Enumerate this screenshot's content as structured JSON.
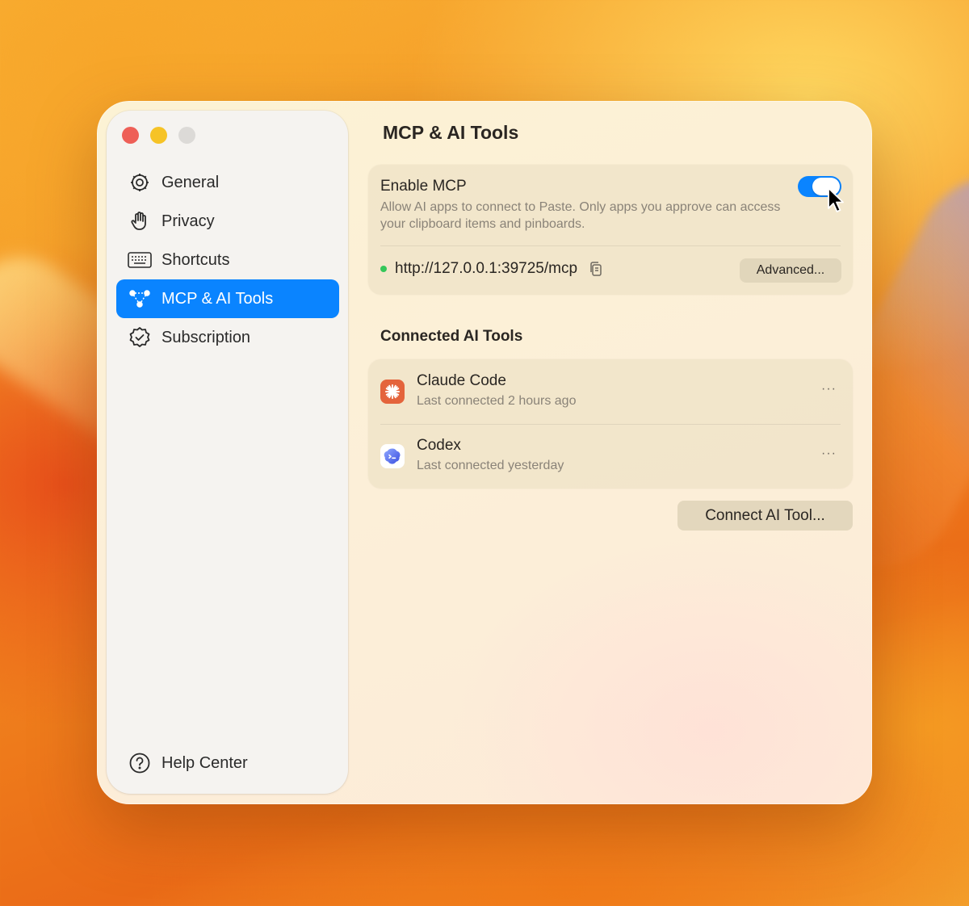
{
  "window": {
    "title": "MCP & AI Tools"
  },
  "sidebar": {
    "items": [
      {
        "label": "General",
        "icon": "gear-icon"
      },
      {
        "label": "Privacy",
        "icon": "hand-icon"
      },
      {
        "label": "Shortcuts",
        "icon": "keyboard-icon"
      },
      {
        "label": "MCP & AI Tools",
        "icon": "network-icon",
        "active": true
      },
      {
        "label": "Subscription",
        "icon": "checkmark-seal-icon"
      }
    ],
    "help_label": "Help Center"
  },
  "mcp": {
    "heading": "Enable MCP",
    "description": "Allow AI apps to connect to Paste. Only apps you approve can access your clipboard items and pinboards.",
    "enabled": true,
    "url": "http://127.0.0.1:39725/mcp",
    "advanced_label": "Advanced..."
  },
  "connected": {
    "heading": "Connected AI Tools",
    "tools": [
      {
        "name": "Claude Code",
        "status": "Last connected 2 hours ago",
        "icon": "claude-icon"
      },
      {
        "name": "Codex",
        "status": "Last connected yesterday",
        "icon": "codex-icon"
      }
    ],
    "more_label": "···",
    "connect_label": "Connect AI Tool..."
  },
  "colors": {
    "accent": "#0a84ff",
    "status_online": "#34c759",
    "close": "#ee5f57",
    "minimize": "#f6c326"
  }
}
